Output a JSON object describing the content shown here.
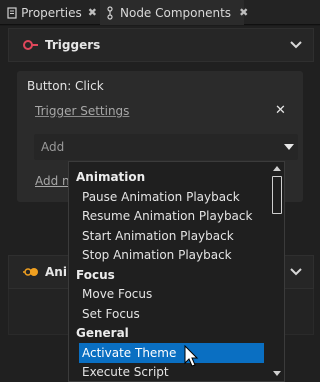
{
  "tabs": [
    {
      "label": "Properties",
      "close": "✖"
    },
    {
      "label": "Node Components",
      "close": "✖"
    }
  ],
  "colors": {
    "selection": "#0a6fc2",
    "triggers_icon": "#e0475b",
    "animation_icon": "#f0a020"
  },
  "triggers_section": {
    "title": "Triggers",
    "icon": "triggers-icon",
    "card_title": "Button: Click",
    "settings_link": "Trigger Settings",
    "remove_glyph": "✕",
    "add_placeholder": "Add",
    "add_link": "Add node"
  },
  "animation_section": {
    "title": "Animations",
    "icon": "animation-icon"
  },
  "dropdown": {
    "rows": [
      {
        "type": "group",
        "label": "Animation"
      },
      {
        "type": "item",
        "label": "Pause Animation Playback"
      },
      {
        "type": "item",
        "label": "Resume Animation Playback"
      },
      {
        "type": "item",
        "label": "Start Animation Playback"
      },
      {
        "type": "item",
        "label": "Stop Animation Playback"
      },
      {
        "type": "group",
        "label": "Focus"
      },
      {
        "type": "item",
        "label": "Move Focus"
      },
      {
        "type": "item",
        "label": "Set Focus"
      },
      {
        "type": "group",
        "label": "General"
      },
      {
        "type": "item",
        "label": "Activate Theme",
        "selected": true
      },
      {
        "type": "item",
        "label": "Execute Script"
      }
    ]
  }
}
